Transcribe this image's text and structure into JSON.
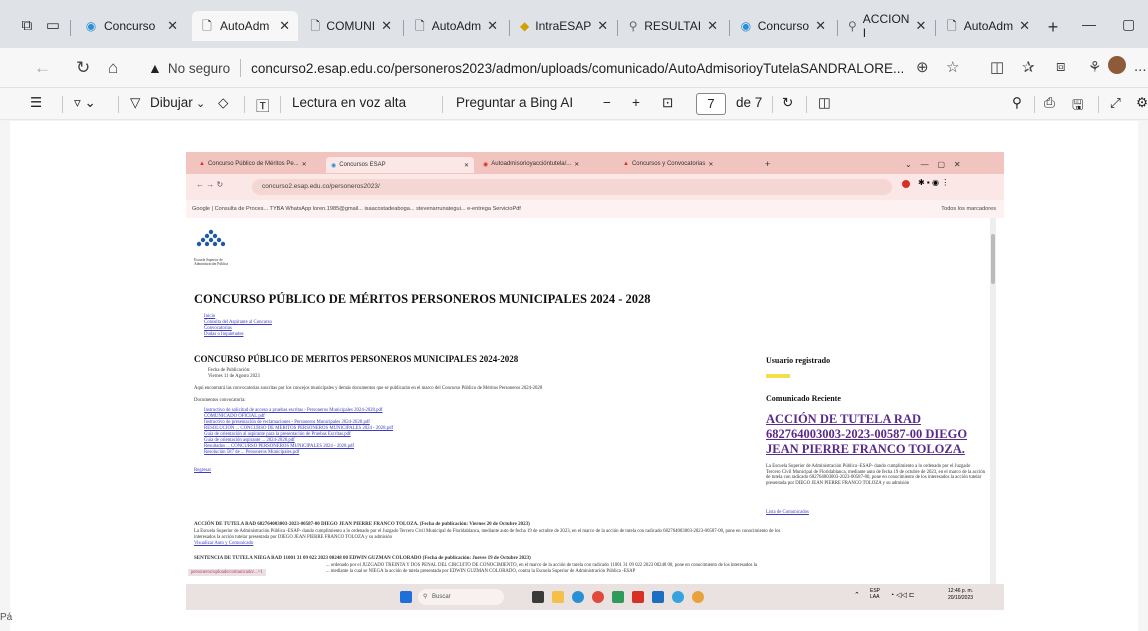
{
  "browser": {
    "tabs": [
      {
        "label": "Concurso",
        "icon": "edge-icon"
      },
      {
        "label": "AutoAdm",
        "icon": "page-icon",
        "active": true
      },
      {
        "label": "COMUNI",
        "icon": "page-icon"
      },
      {
        "label": "AutoAdm",
        "icon": "page-icon"
      },
      {
        "label": "IntraESAP",
        "icon": "site-icon"
      },
      {
        "label": "RESULTAI",
        "icon": "search-icon"
      },
      {
        "label": "Concurso",
        "icon": "edge-icon"
      },
      {
        "label": "ACCION I",
        "icon": "search-icon"
      },
      {
        "label": "AutoAdm",
        "icon": "page-icon"
      }
    ],
    "new_tab": "+",
    "not_secure": "No seguro",
    "url": "concurso2.esap.edu.co/personeros2023/admon/uploads/comunicado/AutoAdmisorioyTutelaSANDRALORE...",
    "more": "..."
  },
  "pdf_toolbar": {
    "draw": "Dibujar",
    "read_aloud": "Lectura en voz alta",
    "ask_bing": "Preguntar a Bing AI",
    "minus": "−",
    "plus": "+",
    "page": "7",
    "of_pages": "de 7"
  },
  "side_text": "Pá",
  "inner_screenshot": {
    "tabs": [
      "Concurso Público de Méritos Pe...",
      "Concursos ESAP",
      "Autoadmisorioyaccióntutela/...",
      "Concursos y Convocatorias"
    ],
    "url": "concurso2.esap.edu.co/personeros2023/",
    "bookmarks": "Google  |  Consulta de Proces...   TYBA   WhatsApp   loren.1985@gmail...   isaacostadeaboga...   stevenarrunategui...   e-entrega   ServicioPdf",
    "bookmarks_right": "Todos los marcadores",
    "logo_text": "Escuela Superior de Administración Pública",
    "title": "CONCURSO PÚBLICO DE MÉRITOS PERSONEROS MUNICIPALES 2024 - 2028",
    "menu": [
      "Inicio",
      "Consulta del Aspirante al Concurso",
      "Convocatorias",
      "Dudas o Inquietudes"
    ],
    "section_title": "CONCURSO PÚBLICO DE MERITOS PERSONEROS MUNICIPALES 2024-2028",
    "pub_date_label": "Fecha de Publicación:",
    "pub_date": "Viernes 11 de Agosto 2023",
    "intro": "Aquí encontrará las convocatorias suscritas por los concejos municipales y demás documentos que se publicarán en el marco del Concurso Público de Méritos Personeros 2024-2028",
    "docs_label": "Documentos convocatoria:",
    "docs": [
      "Instructivo de solicitud de acceso a pruebas escritas - Personeros Municipales 2024-2028.pdf",
      "COMUNICADO OFICIAL.pdf",
      "Instructivo de presentación de reclamaciones - Personeros Municipales 2024-2028.pdf",
      "RESOLUCIÓN ... CONCURSO DE MÉRITOS PERSONEROS MUNICIPALES 2024 - 2028.pdf",
      "Guía de orientación al aspirante para la presentación de Pruebas Escritas.pdf",
      "Guía de orientación aspirante ... 2024-2028.pdf",
      "Resultados ... CONCURSO PERSONEROS MUNICIPALES 2024 - 2028.pdf",
      "Resolución 587 de ... Personeros Municipales.pdf"
    ],
    "back": "Regresar",
    "user_label": "Usuario registrado",
    "recent_label": "Comunicado Reciente",
    "recent_link": "ACCIÓN DE TUTELA RAD 682764003003-2023-00587-00 DIEGO JEAN PIERRE FRANCO TOLOZA.",
    "recent_text": "La Escuela Superior de Administración Pública -ESAP- dando cumplimiento a lo ordenado por el Juzgado Tercero Civil Municipal de Floridablanca, mediante auto de fecha 19 de octubre de 2023, en el marco de la acción de tutela con radicado 682764003003-2023-00587-00, pone en conocimiento de los interesados la acción tutelar presentada por DIEGO JEAN PIERRE FRANCO TOLOZA y su admisión",
    "list_link": "Lista de Comunicados",
    "notice1_title": "ACCIÓN DE TUTELA RAD 682764003003-2023-00587-00 DIEGO JEAN PIERRE FRANCO TOLOZA. (Fecha de publicación: Viernes 20 de Octubre 2023)",
    "notice1_text": "La Escuela Superior de Administración Pública -ESAP- dando cumplimiento a lo ordenado por el Juzgado Tercero Civil Municipal de Floridablanca, mediante auto de fecha 19 de octubre de 2023, en el marco de la acción de tutela con radicado 682764003003-2023-00587-00, pone en conocimiento de los",
    "notice1_text2": "interesados la acción tutelar presentada por DIEGO JEAN PIERRE FRANCO TOLOZA y su admisión",
    "notice1_link": "Visualizar Auto y Comunicado",
    "notice2_title": "SENTENCIA DE TUTELA NIEGA RAD 11001 31 09 022 2023 00248 00 EDWIN GUZMAN COLORADO (Fecha de publicación: Jueves 19 de Octubre 2023)",
    "notice2_text": "... ordenado por el JUZGADO TREINTA Y DOS PENAL DEL CIRCUITO DE CONOCIMIENTO, en el marco de la acción de tutela con radicado 11001 31 09 022 2023 00248 00, pone en conocimiento de los interesados la",
    "notice2_text2": "... mediante la cual se NIEGA la acción de tutela presentada por EDWIN GUZMAN COLORADO, contra la Escuela Superior de Administración Pública -ESAP",
    "hover_url": "personeros/uploads/comunicado/...=1",
    "search": "Buscar",
    "lang": "ESP",
    "lang2": "LAA",
    "time": "12:46 p. m.",
    "date": "20/10/2023"
  },
  "colors": {
    "inner_tabbar": "#f1c4c0",
    "link_purple": "#5a2a8a",
    "accent_red": "#d93025"
  }
}
